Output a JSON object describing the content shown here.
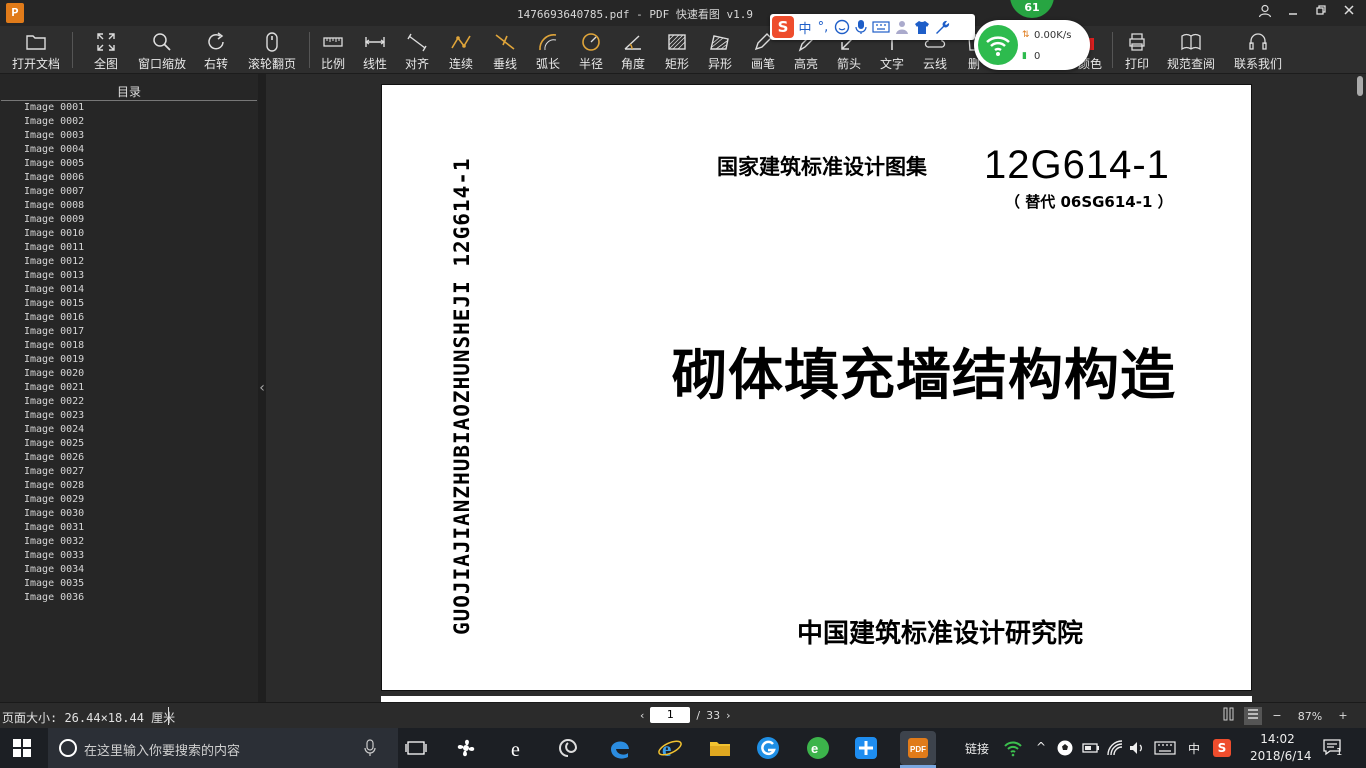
{
  "window": {
    "logo": "P",
    "title": "1476693640785.pdf - PDF 快速看图 v1.9",
    "controls": [
      "user-icon",
      "minimize-icon",
      "maximize-icon",
      "close-icon"
    ]
  },
  "toolbar": {
    "items": [
      {
        "id": "open",
        "label": "打开文档",
        "icon": "folder-icon"
      },
      {
        "id": "fit",
        "label": "全图",
        "icon": "expand-icon"
      },
      {
        "id": "zoom",
        "label": "窗口缩放",
        "icon": "magnifier-icon"
      },
      {
        "id": "rotate",
        "label": "右转",
        "icon": "rotate-icon"
      },
      {
        "id": "scrollpage",
        "label": "滚轮翻页",
        "icon": "mouse-icon"
      },
      {
        "id": "scale",
        "label": "比例",
        "icon": "ruler-icon"
      },
      {
        "id": "linear",
        "label": "线性",
        "icon": "linear-dim-icon"
      },
      {
        "id": "aligned",
        "label": "对齐",
        "icon": "aligned-dim-icon"
      },
      {
        "id": "continuous",
        "label": "连续",
        "icon": "polyline-icon"
      },
      {
        "id": "perp",
        "label": "垂线",
        "icon": "perpendicular-icon"
      },
      {
        "id": "arc",
        "label": "弧长",
        "icon": "arc-icon"
      },
      {
        "id": "radius",
        "label": "半径",
        "icon": "radius-icon"
      },
      {
        "id": "angle",
        "label": "角度",
        "icon": "angle-icon"
      },
      {
        "id": "rect",
        "label": "矩形",
        "icon": "rect-area-icon"
      },
      {
        "id": "irregular",
        "label": "异形",
        "icon": "irregular-area-icon"
      },
      {
        "id": "pen",
        "label": "画笔",
        "icon": "pen-icon"
      },
      {
        "id": "highlight",
        "label": "高亮",
        "icon": "highlighter-icon"
      },
      {
        "id": "arrow",
        "label": "箭头",
        "icon": "arrow-icon"
      },
      {
        "id": "text",
        "label": "文字",
        "icon": "text-icon"
      },
      {
        "id": "cloud",
        "label": "云线",
        "icon": "cloud-icon"
      },
      {
        "id": "delete",
        "label": "删",
        "icon": "delete-icon"
      },
      {
        "id": "color",
        "label": "颜色",
        "icon": "color-icon"
      },
      {
        "id": "print",
        "label": "打印",
        "icon": "printer-icon"
      },
      {
        "id": "standard",
        "label": "规范查阅",
        "icon": "book-icon"
      },
      {
        "id": "contact",
        "label": "联系我们",
        "icon": "headset-icon"
      }
    ]
  },
  "ime": {
    "logo": "S",
    "lang": "中",
    "punct": "°,",
    "items": [
      "smile-icon",
      "mic-icon",
      "keyboard-icon",
      "user-icon",
      "shirt-icon",
      "wrench-icon"
    ]
  },
  "network": {
    "badge": "61",
    "speed": "0.00K/s",
    "count": "0"
  },
  "sidebar": {
    "title": "目录",
    "items": [
      "Image 0001",
      "Image 0002",
      "Image 0003",
      "Image 0004",
      "Image 0005",
      "Image 0006",
      "Image 0007",
      "Image 0008",
      "Image 0009",
      "Image 0010",
      "Image 0011",
      "Image 0012",
      "Image 0013",
      "Image 0014",
      "Image 0015",
      "Image 0016",
      "Image 0017",
      "Image 0018",
      "Image 0019",
      "Image 0020",
      "Image 0021",
      "Image 0022",
      "Image 0023",
      "Image 0024",
      "Image 0025",
      "Image 0026",
      "Image 0027",
      "Image 0028",
      "Image 0029",
      "Image 0030",
      "Image 0031",
      "Image 0032",
      "Image 0033",
      "Image 0034",
      "Image 0035",
      "Image 0036"
    ]
  },
  "document": {
    "series": "国家建筑标准设计图集",
    "code": "12G614-1",
    "replaces": "（ 替代  06SG614-1 ）",
    "title": "砌体填充墙结构构造",
    "publisher": "中国建筑标准设计研究院",
    "spine": "GUOJIAJIANZHUBIAOZHUNSHEJI 12G614-1"
  },
  "status": {
    "page_size": "页面大小: 26.44×18.44 厘米",
    "current_page": "1",
    "separator": "/",
    "total_pages": "33",
    "zoom": "87%"
  },
  "taskbar": {
    "search_placeholder": "在这里输入你要搜索的内容",
    "tray_link": "链接",
    "ime_lang": "中",
    "time": "14:02",
    "date": "2018/6/14",
    "notifications": "1"
  }
}
